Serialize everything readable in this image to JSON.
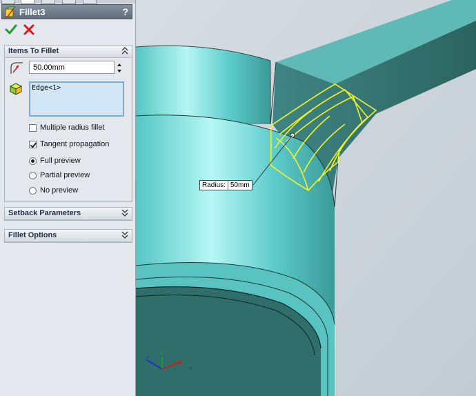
{
  "panel": {
    "title": "Fillet3",
    "help": "?",
    "ok_label": "OK",
    "cancel_label": "Cancel"
  },
  "items_to_fillet": {
    "heading": "Items To Fillet",
    "radius_value": "50.00mm",
    "selected_edges": "Edge<1>",
    "multiple_radius": {
      "label": "Multiple radius fillet",
      "checked": false
    },
    "tangent_propagation": {
      "label": "Tangent propagation",
      "checked": true
    },
    "preview_options": [
      {
        "label": "Full preview",
        "selected": true
      },
      {
        "label": "Partial preview",
        "selected": false
      },
      {
        "label": "No preview",
        "selected": false
      }
    ]
  },
  "groups": {
    "setback": "Setback Parameters",
    "fillet_options": "Fillet Options"
  },
  "callout": {
    "label": "Radius:",
    "value": "50mm"
  },
  "colors": {
    "model": "#58c8c6",
    "model_light": "#a8f0ee",
    "model_dark": "#2d6b68",
    "fillet_preview": "#f5f525",
    "background": "#cfd6dc"
  },
  "icons": [
    "fillet-feature-icon",
    "ok-check-icon",
    "cancel-x-icon",
    "radius-icon",
    "edge-selection-icon",
    "collapse-chevron-icon",
    "expand-chevron-icon",
    "triad-icon"
  ]
}
